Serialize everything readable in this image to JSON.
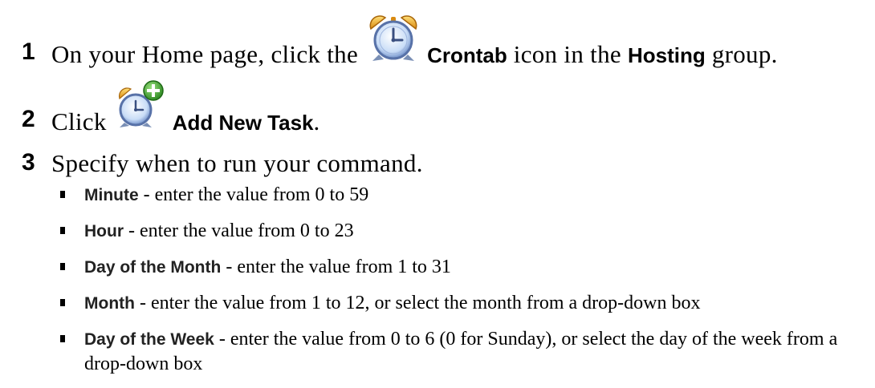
{
  "steps": [
    {
      "number": "1",
      "before": "On your Home page, click the ",
      "icon": "crontab-clock-icon",
      "ui_label": "Crontab",
      "middle": " icon in the ",
      "ui_label2": "Hosting",
      "after": " group."
    },
    {
      "number": "2",
      "before": "Click ",
      "icon": "add-task-clock-icon",
      "ui_label": "Add New Task",
      "after": "."
    },
    {
      "number": "3",
      "text": "Specify when to run your command."
    }
  ],
  "bullets": [
    {
      "term": "Minute",
      "text": " - enter the value from 0 to 59"
    },
    {
      "term": "Hour",
      "text": " - enter the value from 0 to 23"
    },
    {
      "term": "Day of the Month",
      "text": " - enter the value from 1 to 31"
    },
    {
      "term": "Month",
      "text": " - enter the value from 1 to 12, or select the month from a drop-down box"
    },
    {
      "term": "Day of the Week",
      "text": " - enter the value from 0 to 6 (0 for Sunday), or select the day of the week from a drop-down box"
    }
  ],
  "colors": {
    "text": "#000000",
    "clock_face": "#c9ddf7",
    "clock_bell": "#f2a623",
    "plus_badge": "#3a9a2c"
  }
}
